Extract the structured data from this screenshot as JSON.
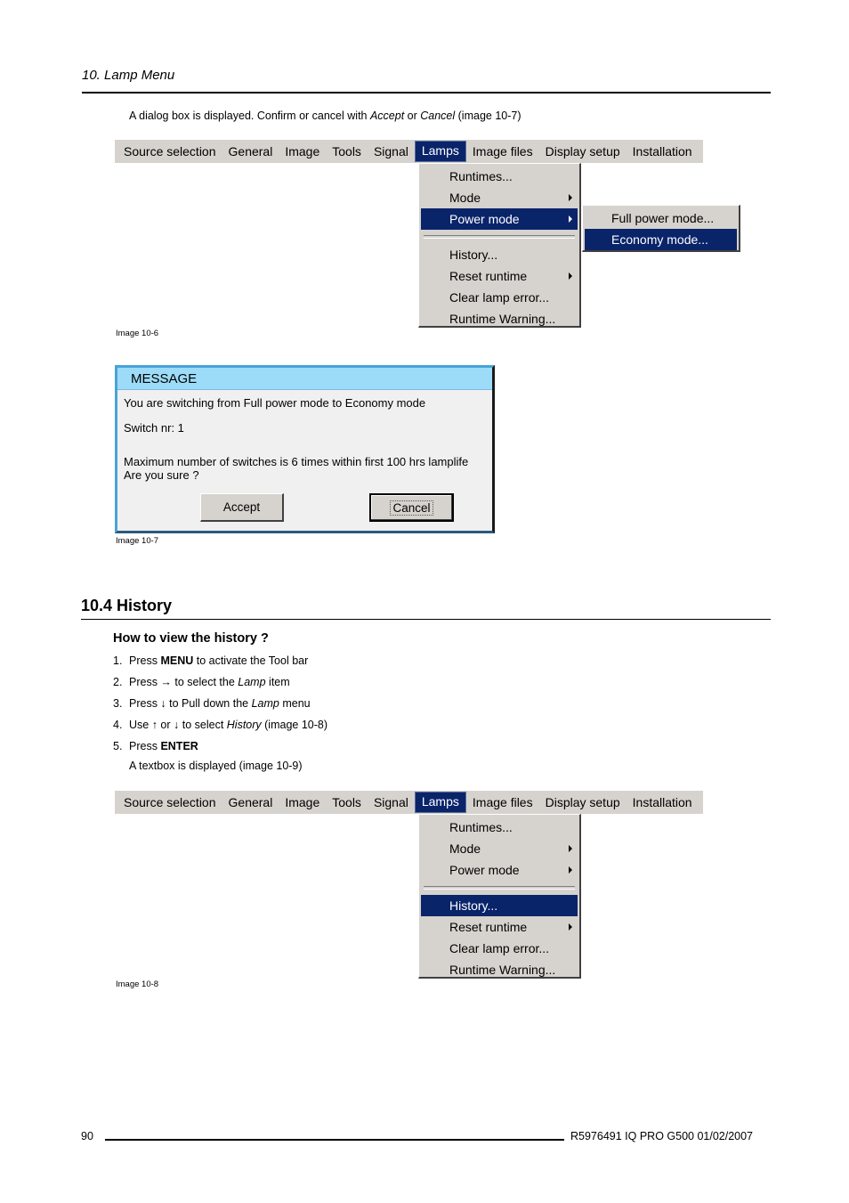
{
  "header": {
    "chapter_title": "10.  Lamp Menu"
  },
  "intro": {
    "prefix": "A dialog box is displayed.  Confirm or cancel with ",
    "accept": "Accept",
    "or": " or ",
    "cancel": "Cancel",
    "suffix": " (image 10-7)"
  },
  "menubar": {
    "items": [
      "Source selection",
      "General",
      "Image",
      "Tools",
      "Signal",
      "Lamps",
      "Image files",
      "Display setup",
      "Installation"
    ],
    "active": "Lamps"
  },
  "figure1": {
    "dropdown": {
      "items": [
        {
          "label": "Runtimes...",
          "submenu": false
        },
        {
          "label": "Mode",
          "submenu": true
        },
        {
          "label": "Power mode",
          "submenu": true,
          "selected": true
        },
        {
          "label": "History...",
          "submenu": false
        },
        {
          "label": "Reset runtime",
          "submenu": true
        },
        {
          "label": "Clear lamp error...",
          "submenu": false
        },
        {
          "label": "Runtime Warning...",
          "submenu": false
        }
      ]
    },
    "submenu": {
      "items": [
        {
          "label": "Full power mode..."
        },
        {
          "label": "Economy mode...",
          "selected": true
        }
      ]
    },
    "caption": "Image 10-6"
  },
  "dialog": {
    "title": "MESSAGE",
    "line1": "You are switching from Full power mode to Economy mode",
    "line2": "Switch nr: 1",
    "line3": "Maximum number of switches is 6 times within first 100 hrs   lamplife",
    "line4": "Are you sure ?",
    "accept_label": "Accept",
    "cancel_label": "Cancel",
    "caption": "Image 10-7"
  },
  "section": {
    "title": "10.4  History",
    "subtitle": "How to view the history ?",
    "steps": [
      {
        "num": "1.",
        "parts": [
          {
            "t": "Press "
          },
          {
            "t": "MENU",
            "b": true
          },
          {
            "t": " to activate the Tool bar"
          }
        ]
      },
      {
        "num": "2.",
        "parts": [
          {
            "t": "Press → to select the "
          },
          {
            "t": "Lamp",
            "i": true
          },
          {
            "t": " item"
          }
        ]
      },
      {
        "num": "3.",
        "parts": [
          {
            "t": "Press ↓ to Pull down the "
          },
          {
            "t": "Lamp",
            "i": true
          },
          {
            "t": " menu"
          }
        ]
      },
      {
        "num": "4.",
        "parts": [
          {
            "t": "Use ↑ or ↓ to select "
          },
          {
            "t": "History",
            "i": true
          },
          {
            "t": " (image 10-8)"
          }
        ]
      },
      {
        "num": "5.",
        "parts": [
          {
            "t": "Press "
          },
          {
            "t": "ENTER",
            "b": true
          }
        ]
      }
    ],
    "result": "A textbox is displayed (image 10-9)"
  },
  "figure3": {
    "dropdown": {
      "items": [
        {
          "label": "Runtimes...",
          "submenu": false
        },
        {
          "label": "Mode",
          "submenu": true
        },
        {
          "label": "Power mode",
          "submenu": true
        },
        {
          "label": "History...",
          "submenu": false,
          "selected": true
        },
        {
          "label": "Reset runtime",
          "submenu": true
        },
        {
          "label": "Clear lamp error...",
          "submenu": false
        },
        {
          "label": "Runtime Warning...",
          "submenu": false
        }
      ]
    },
    "caption": "Image 10-8"
  },
  "footer": {
    "page_number": "90",
    "doc_info": "R5976491   IQ PRO G500  01/02/2007"
  }
}
